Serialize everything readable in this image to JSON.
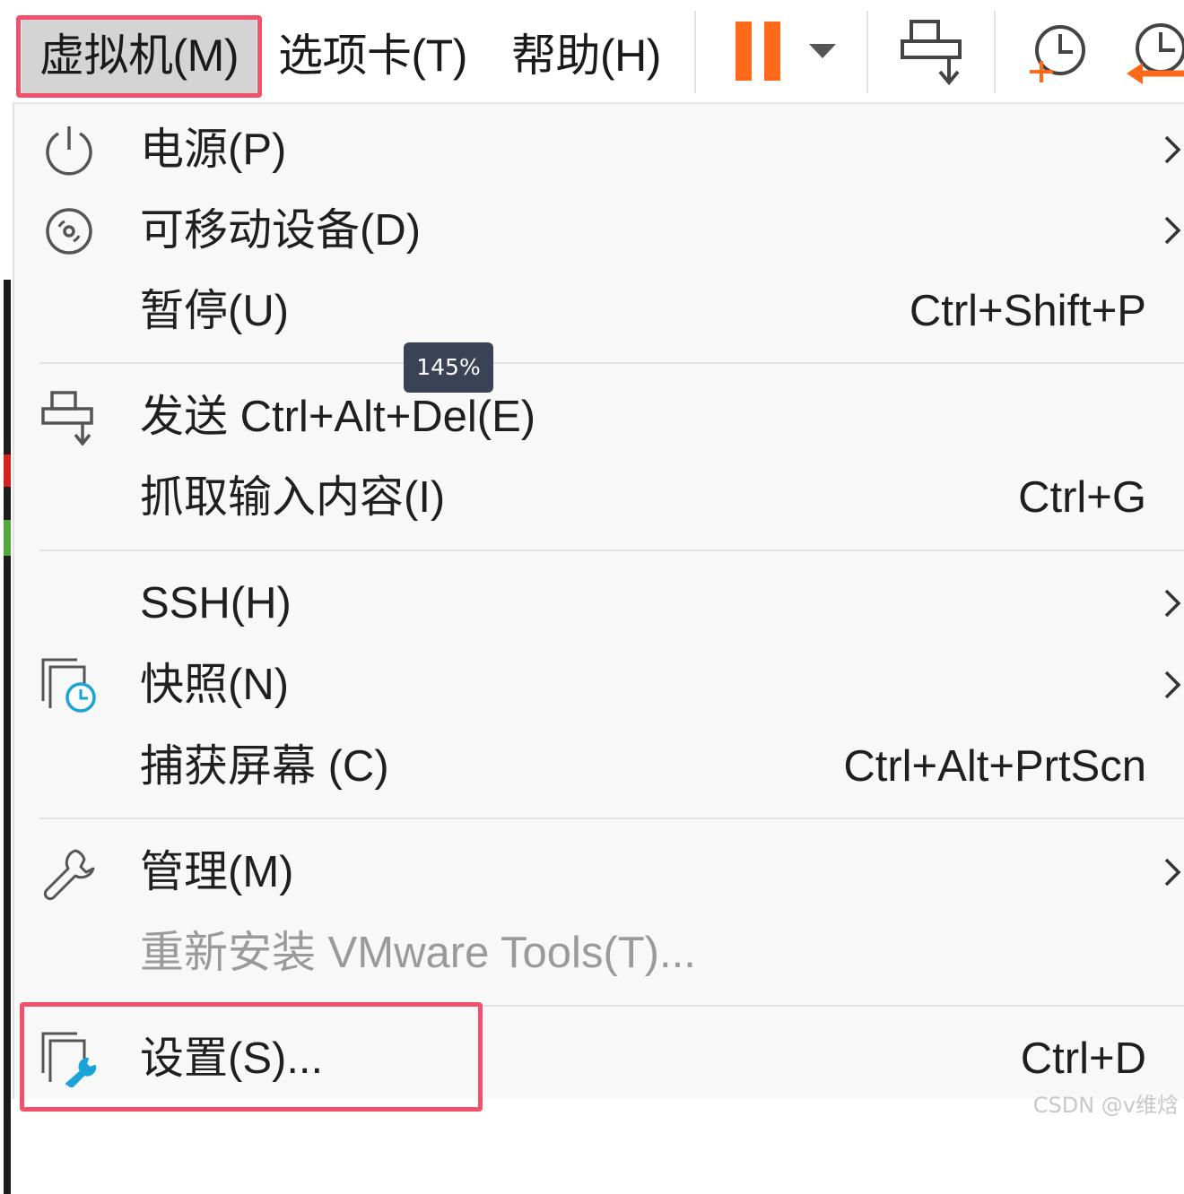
{
  "menubar": {
    "vm_label": "虚拟机(M)",
    "tabs_label": "选项卡(T)",
    "help_label": "帮助(H)",
    "toolbar_icons": [
      "pause-icon",
      "dropdown-caret-icon",
      "send-ctrl-alt-del-icon",
      "take-snapshot-icon",
      "revert-snapshot-icon"
    ]
  },
  "colors": {
    "highlight": "#f2506c",
    "pause_orange": "#ff6a1a",
    "menu_bg": "#f8f8f8",
    "selected_menu_bg": "#d4d4d4"
  },
  "menu": {
    "items": [
      {
        "label": "电源(P)",
        "icon": "power-icon",
        "submenu": true
      },
      {
        "label": "可移动设备(D)",
        "icon": "disc-icon",
        "submenu": true
      },
      {
        "label": "暂停(U)",
        "shortcut": "Ctrl+Shift+P"
      },
      {
        "label": "发送 Ctrl+Alt+Del(E)",
        "icon": "send-ctrl-alt-del-icon"
      },
      {
        "label": "抓取输入内容(I)",
        "shortcut": "Ctrl+G"
      },
      {
        "label": "SSH(H)",
        "submenu": true
      },
      {
        "label": "快照(N)",
        "icon": "snapshot-icon",
        "submenu": true
      },
      {
        "label": "捕获屏幕 (C)",
        "shortcut": "Ctrl+Alt+PrtScn"
      },
      {
        "label": "管理(M)",
        "icon": "wrench-icon",
        "submenu": true
      },
      {
        "label": "重新安装 VMware Tools(T)...",
        "disabled": true
      },
      {
        "label": "设置(S)...",
        "icon": "settings-icon",
        "shortcut": "Ctrl+D"
      }
    ]
  },
  "zoom_badge": "145%",
  "watermark": "CSDN @v维焓"
}
